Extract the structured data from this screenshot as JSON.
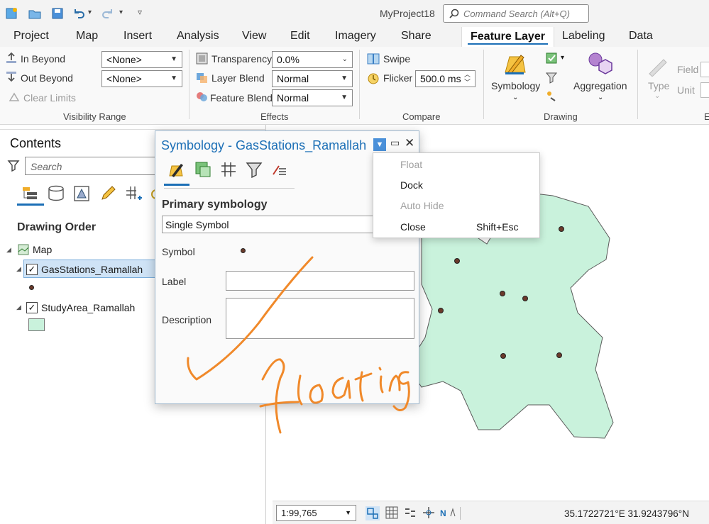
{
  "app": {
    "project_title": "MyProject18"
  },
  "search": {
    "placeholder": "Command Search (Alt+Q)"
  },
  "tabs": [
    {
      "label": "Project"
    },
    {
      "label": "Map"
    },
    {
      "label": "Insert"
    },
    {
      "label": "Analysis"
    },
    {
      "label": "View"
    },
    {
      "label": "Edit"
    },
    {
      "label": "Imagery"
    },
    {
      "label": "Share"
    },
    {
      "label": "Feature Layer"
    },
    {
      "label": "Labeling"
    },
    {
      "label": "Data"
    }
  ],
  "ribbon": {
    "visibility": {
      "in_beyond": "In Beyond",
      "out_beyond": "Out Beyond",
      "clear_limits": "Clear Limits",
      "in_value": "<None>",
      "out_value": "<None>",
      "group": "Visibility Range"
    },
    "effects": {
      "transparency": "Transparency",
      "transparency_value": "0.0%",
      "layer_blend": "Layer Blend",
      "layer_blend_value": "Normal",
      "feature_blend": "Feature Blend",
      "feature_blend_value": "Normal",
      "group": "Effects"
    },
    "compare": {
      "swipe": "Swipe",
      "flicker": "Flicker",
      "flicker_value": "500.0  ms",
      "group": "Compare"
    },
    "drawing": {
      "symbology": "Symbology",
      "aggregation": "Aggregation",
      "group": "Drawing"
    },
    "extra": {
      "type": "Type",
      "field": "Field",
      "unit": "Unit",
      "group_partial": "E"
    }
  },
  "contents": {
    "title": "Contents",
    "search_placeholder": "Search",
    "drawing_order": "Drawing Order",
    "layers": [
      {
        "name": "Map"
      },
      {
        "name": "GasStations_Ramallah"
      },
      {
        "name": "StudyArea_Ramallah"
      }
    ]
  },
  "dialog": {
    "title": "Symbology - GasStations_Ramallah",
    "section": "Primary symbology",
    "symbology_type": "Single Symbol",
    "symbol_label": "Symbol",
    "label_label": "Label",
    "description_label": "Description",
    "label_value": "",
    "description_value": ""
  },
  "menu": {
    "items": [
      {
        "label": "Float",
        "enabled": false,
        "shortcut": ""
      },
      {
        "label": "Dock",
        "enabled": true,
        "shortcut": ""
      },
      {
        "label": "Auto Hide",
        "enabled": false,
        "shortcut": ""
      },
      {
        "label": "Close",
        "enabled": true,
        "shortcut": "Shift+Esc"
      }
    ]
  },
  "status": {
    "scale": "1:99,765",
    "coordinates": "35.1722721°E 31.9243796°N"
  },
  "colors": {
    "accent": "#1c6fb6",
    "studyarea_fill": "#c9f2dc",
    "annotation": "#f0892a",
    "point": "#6b3a2a"
  }
}
